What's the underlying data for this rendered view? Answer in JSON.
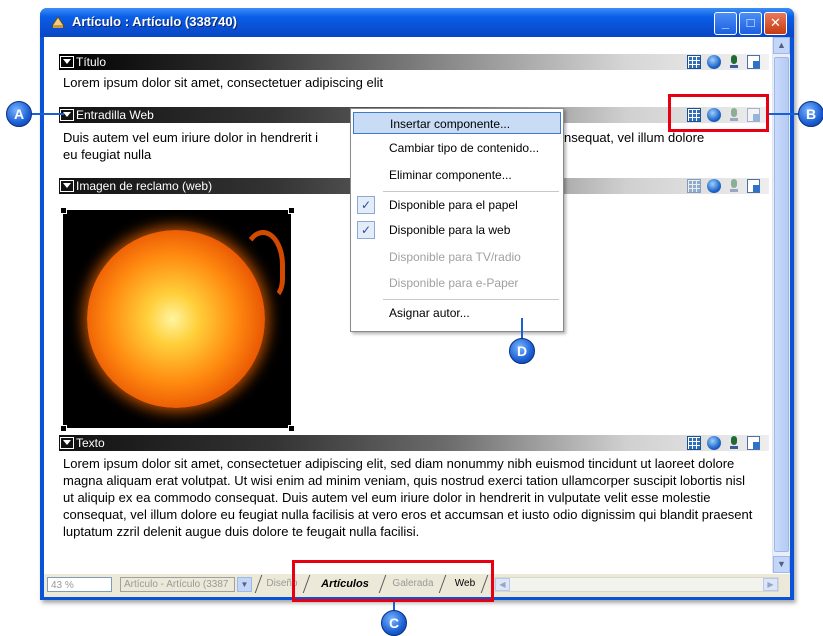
{
  "window": {
    "title": "Artículo : Artículo (338740)",
    "buttons": {
      "minimize": "_",
      "maximize": "□",
      "close": "✕"
    }
  },
  "sections": [
    {
      "header": "Título",
      "body": "Lorem ipsum dolor sit amet, consectetuer adipiscing elit"
    },
    {
      "header": "Entradilla Web",
      "body_left": "Duis autem vel eum iriure dolor in hendrerit i",
      "body_right": "nsequat, vel illum dolore",
      "body_line2": "eu feugiat nulla"
    },
    {
      "header": "Imagen de reclamo (web)"
    },
    {
      "header": "Texto",
      "body": "Lorem ipsum dolor sit amet, consectetuer adipiscing elit, sed diam nonummy nibh euismod tincidunt ut laoreet dolore magna aliquam erat volutpat. Ut wisi enim ad minim veniam, quis nostrud exerci tation ullamcorper suscipit lobortis nisl ut aliquip ex ea commodo consequat. Duis autem vel eum iriure dolor in hendrerit in vulputate velit esse molestie consequat, vel illum dolore eu feugiat nulla facilisis at vero eros et accumsan et iusto odio dignissim qui blandit praesent luptatum zzril delenit augue duis dolore te feugait nulla facilisi."
    }
  ],
  "context_menu": {
    "items": [
      {
        "label": "Insertar componente...",
        "state": "highlighted"
      },
      {
        "label": "Cambiar tipo de contenido...",
        "state": "normal"
      },
      {
        "label": "Eliminar componente...",
        "state": "normal"
      },
      {
        "label": "Disponible para el papel",
        "state": "checked"
      },
      {
        "label": "Disponible para la web",
        "state": "checked"
      },
      {
        "label": "Disponible para TV/radio",
        "state": "disabled"
      },
      {
        "label": "Disponible para e-Paper",
        "state": "disabled"
      },
      {
        "label": "Asignar autor...",
        "state": "normal"
      }
    ]
  },
  "statusbar": {
    "zoom": "43 %",
    "document": "Artículo - Artículo (3387",
    "tabs": [
      "Diseño",
      "Artículos",
      "Galerada",
      "Web"
    ],
    "active_tab": "Artículos"
  },
  "callouts": [
    "A",
    "B",
    "C",
    "D"
  ],
  "colors": {
    "accent": "#0a53d8",
    "highlight_box": "#e60012",
    "callout": "#1a5fd4"
  }
}
